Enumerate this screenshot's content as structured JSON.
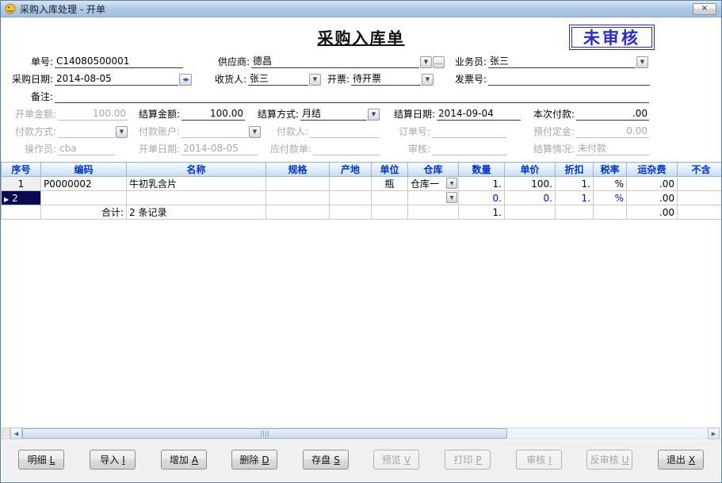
{
  "window": {
    "title": "采购入库处理 - 开单"
  },
  "doc": {
    "title": "采购入库单",
    "stamp": "未审核"
  },
  "icons": {
    "close": "×",
    "dropdown": "▼",
    "ellipsis": "…",
    "date_spinner": "◀▶",
    "row_marker": "▶",
    "scroll_left": "◀",
    "scroll_right": "▶"
  },
  "fields": {
    "order_no": {
      "label": "单号:",
      "value": "C14080500001"
    },
    "supplier": {
      "label": "供应商:",
      "value": "德昌"
    },
    "salesman": {
      "label": "业务员:",
      "value": "张三"
    },
    "purchase_date": {
      "label": "采购日期:",
      "value": "2014-08-05"
    },
    "receiver": {
      "label": "收货人:",
      "value": "张三"
    },
    "invoice_status": {
      "label": "开票:",
      "value": "待开票"
    },
    "invoice_no": {
      "label": "发票号:",
      "value": ""
    },
    "remark": {
      "label": "备注:",
      "value": ""
    },
    "order_amount": {
      "label": "开单金额:",
      "value": "100.00"
    },
    "settle_amount": {
      "label": "结算金额:",
      "value": "100.00"
    },
    "settle_method": {
      "label": "结算方式:",
      "value": "月结"
    },
    "settle_date": {
      "label": "结算日期:",
      "value": "2014-09-04"
    },
    "payment_now": {
      "label": "本次付款:",
      "value": ".00"
    },
    "pay_method": {
      "label": "付款方式:",
      "value": ""
    },
    "pay_account": {
      "label": "付款账户:",
      "value": ""
    },
    "payer": {
      "label": "付款人:",
      "value": ""
    },
    "po_no": {
      "label": "订单号:",
      "value": ""
    },
    "deposit": {
      "label": "预付定金:",
      "value": "0.00"
    },
    "operator": {
      "label": "操作员:",
      "value": "cba"
    },
    "billing_date": {
      "label": "开单日期:",
      "value": "2014-08-05"
    },
    "payable_bill": {
      "label": "应付款单:",
      "value": ""
    },
    "audit": {
      "label": "审核:",
      "value": ""
    },
    "settle_status": {
      "label": "结算情况:",
      "value": "未付款"
    }
  },
  "grid": {
    "headers": [
      "序号",
      "编码",
      "名称",
      "规格",
      "产地",
      "单位",
      "仓库",
      "数量",
      "单价",
      "折扣",
      "税率",
      "运杂费",
      "不含"
    ],
    "rows": [
      {
        "seq": "1",
        "code": "P0000002",
        "name": "牛初乳含片",
        "spec": "",
        "origin": "",
        "unit": "瓶",
        "warehouse": "仓库一",
        "qty": "1.",
        "price": "100.",
        "discount": "1.",
        "tax": "%",
        "freight": ".00",
        "notax": ""
      },
      {
        "seq": "2",
        "code": "",
        "name": "",
        "spec": "",
        "origin": "",
        "unit": "",
        "warehouse": "",
        "qty": "0.",
        "price": "0.",
        "discount": "1.",
        "tax": "%",
        "freight": ".00",
        "notax": ""
      }
    ],
    "total": {
      "label": "合计:",
      "records": "2 条记录",
      "qty": "1.",
      "freight": ".00"
    }
  },
  "buttons": [
    {
      "label": "明细",
      "key": "L",
      "enabled": true
    },
    {
      "label": "导入",
      "key": "I",
      "enabled": true
    },
    {
      "label": "增加",
      "key": "A",
      "enabled": true
    },
    {
      "label": "删除",
      "key": "D",
      "enabled": true
    },
    {
      "label": "存盘",
      "key": "S",
      "enabled": true
    },
    {
      "label": "预览",
      "key": "V",
      "enabled": false
    },
    {
      "label": "打印",
      "key": "P",
      "enabled": false
    },
    {
      "label": "审核",
      "key": "I",
      "enabled": false
    },
    {
      "label": "反审核",
      "key": "U",
      "enabled": false
    },
    {
      "label": "退出",
      "key": "X",
      "enabled": true
    }
  ],
  "colors": {
    "header_text_blue": "#0033cc",
    "stamp_blue": "#2c2ccd",
    "editing_value_blue": "#0008e8",
    "disabled_text": "#a8a8a8"
  }
}
